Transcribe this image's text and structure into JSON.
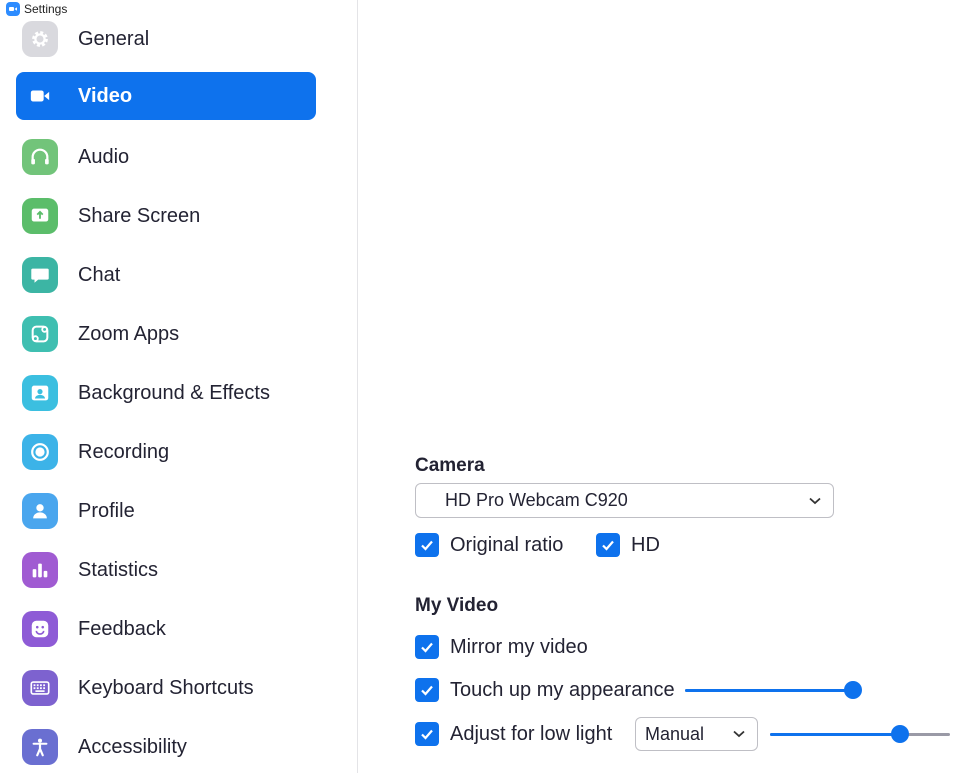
{
  "window": {
    "title": "Settings"
  },
  "sidebar": {
    "items": [
      {
        "label": "General",
        "icon": "gear-icon",
        "color": "#d7d7dc",
        "active": false
      },
      {
        "label": "Video",
        "icon": "video-camera-icon",
        "color": "#0e72ed",
        "active": true
      },
      {
        "label": "Audio",
        "icon": "headphones-icon",
        "color": "#6cc070",
        "active": false
      },
      {
        "label": "Share Screen",
        "icon": "share-screen-icon",
        "color": "#5bbd6a",
        "active": false
      },
      {
        "label": "Chat",
        "icon": "chat-bubble-icon",
        "color": "#3cb5a4",
        "active": false
      },
      {
        "label": "Zoom Apps",
        "icon": "apps-icon",
        "color": "#3fbfb1",
        "active": false
      },
      {
        "label": "Background & Effects",
        "icon": "background-icon",
        "color": "#3bbfe0",
        "active": false
      },
      {
        "label": "Recording",
        "icon": "record-icon",
        "color": "#3cb3e8",
        "active": false
      },
      {
        "label": "Profile",
        "icon": "profile-icon",
        "color": "#4aa6ee",
        "active": false
      },
      {
        "label": "Statistics",
        "icon": "statistics-icon",
        "color": "#9b59d0",
        "active": false
      },
      {
        "label": "Feedback",
        "icon": "feedback-icon",
        "color": "#8e5bd6",
        "active": false
      },
      {
        "label": "Keyboard Shortcuts",
        "icon": "keyboard-icon",
        "color": "#7d62cf",
        "active": false
      },
      {
        "label": "Accessibility",
        "icon": "accessibility-icon",
        "color": "#6a6fd1",
        "active": false
      }
    ]
  },
  "camera": {
    "title": "Camera",
    "device": "HD Pro Webcam C920",
    "original_ratio": {
      "label": "Original ratio",
      "checked": true
    },
    "hd": {
      "label": "HD",
      "checked": true
    }
  },
  "my_video": {
    "title": "My Video",
    "mirror": {
      "label": "Mirror my video",
      "checked": true
    },
    "touch_up": {
      "label": "Touch up my appearance",
      "checked": true,
      "level": 1.0
    },
    "low_light": {
      "label": "Adjust for low light",
      "checked": true,
      "mode": "Manual",
      "level": 0.72
    }
  },
  "colors": {
    "accent": "#0e72ed",
    "text": "#232333",
    "border": "#e4e4e7"
  }
}
